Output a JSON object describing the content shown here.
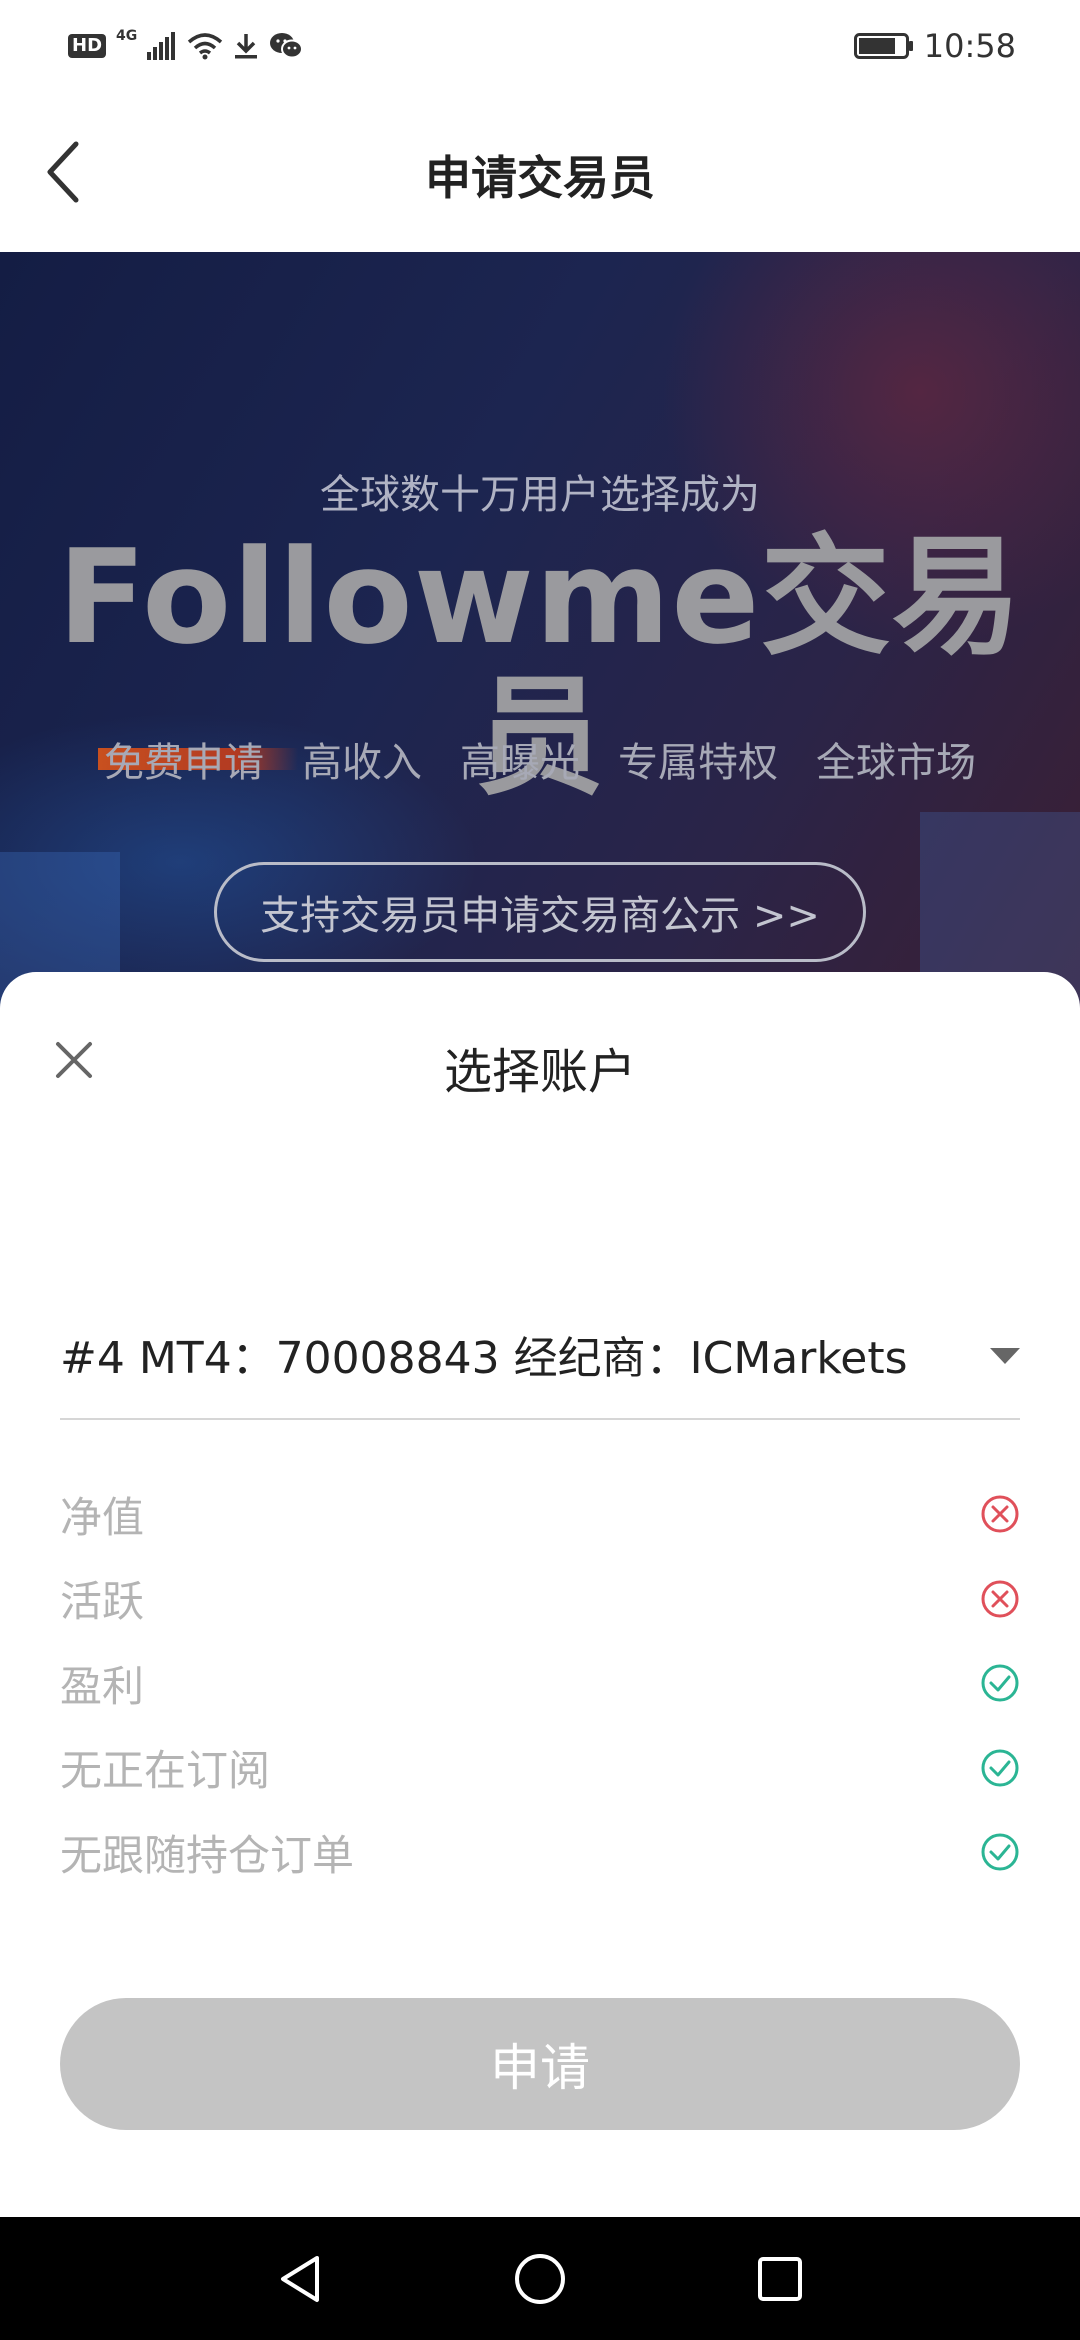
{
  "status_bar": {
    "hd": "HD",
    "signal": "4G",
    "time": "10:58"
  },
  "header": {
    "title": "申请交易员"
  },
  "banner": {
    "subtitle": "全球数十万用户选择成为",
    "headline": "Followme交易员",
    "tags": [
      "免费申请",
      "高收入",
      "高曝光",
      "专属特权",
      "全球市场"
    ],
    "disclosure_button": "支持交易员申请交易商公示 >>"
  },
  "sheet": {
    "title": "选择账户",
    "selected_account": "#4 MT4：70008843 经纪商：ICMarkets",
    "criteria": [
      {
        "label": "净值",
        "status": "fail"
      },
      {
        "label": "活跃",
        "status": "fail"
      },
      {
        "label": "盈利",
        "status": "pass"
      },
      {
        "label": "无正在订阅",
        "status": "pass"
      },
      {
        "label": "无跟随持仓订单",
        "status": "pass"
      }
    ],
    "apply_button": "申请"
  },
  "colors": {
    "fail": "#e0505a",
    "pass": "#2bb594",
    "button_disabled": "#c4c4c4"
  },
  "icons": {
    "fail": "x-circle-icon",
    "pass": "check-circle-icon"
  }
}
